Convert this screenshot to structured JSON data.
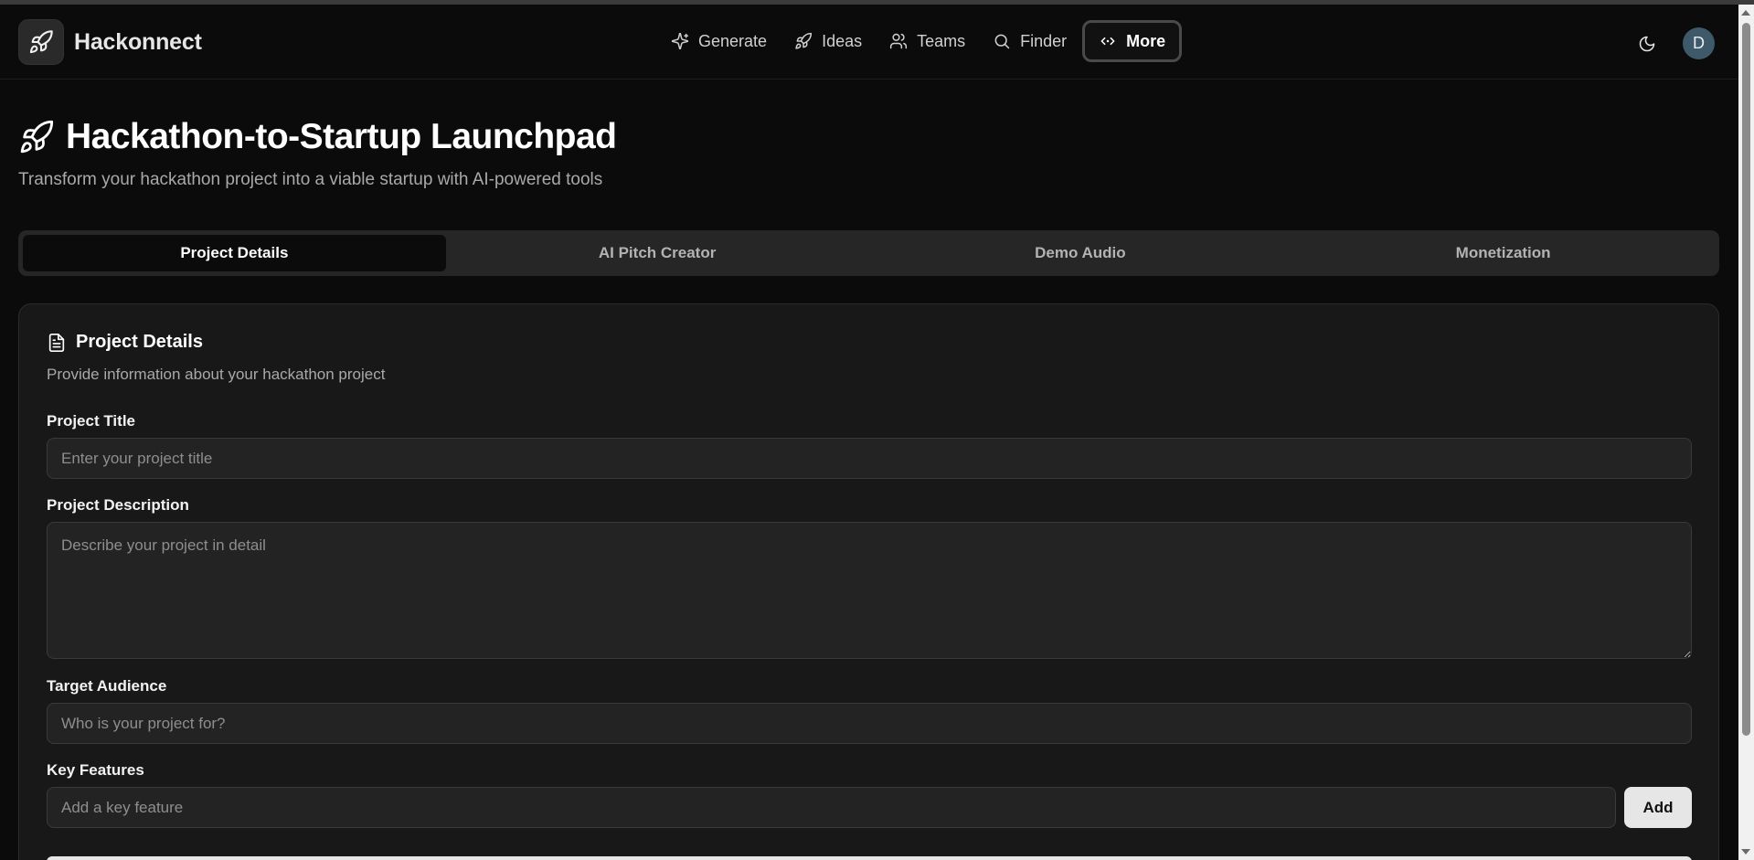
{
  "brand": {
    "name": "Hackonnect"
  },
  "nav": {
    "items": [
      {
        "label": "Generate",
        "icon": "sparkles-icon"
      },
      {
        "label": "Ideas",
        "icon": "rocket-icon"
      },
      {
        "label": "Teams",
        "icon": "users-icon"
      },
      {
        "label": "Finder",
        "icon": "search-icon"
      },
      {
        "label": "More",
        "icon": "code-icon",
        "active": true
      }
    ]
  },
  "user": {
    "avatar_initial": "D"
  },
  "hero": {
    "title": "Hackathon-to-Startup Launchpad",
    "subtitle": "Transform your hackathon project into a viable startup with AI-powered tools"
  },
  "tabs": [
    {
      "label": "Project Details",
      "active": true
    },
    {
      "label": "AI Pitch Creator"
    },
    {
      "label": "Demo Audio"
    },
    {
      "label": "Monetization"
    }
  ],
  "card": {
    "title": "Project Details",
    "description": "Provide information about your hackathon project",
    "fields": {
      "title": {
        "label": "Project Title",
        "placeholder": "Enter your project title",
        "value": ""
      },
      "description": {
        "label": "Project Description",
        "placeholder": "Describe your project in detail",
        "value": ""
      },
      "audience": {
        "label": "Target Audience",
        "placeholder": "Who is your project for?",
        "value": ""
      },
      "features": {
        "label": "Key Features",
        "placeholder": "Add a key feature",
        "value": "",
        "add_label": "Add"
      }
    }
  },
  "colors": {
    "background": "#0b0b0b",
    "card": "#181818",
    "accent": "#e6e6e6",
    "avatar": "#3e5a6a"
  }
}
